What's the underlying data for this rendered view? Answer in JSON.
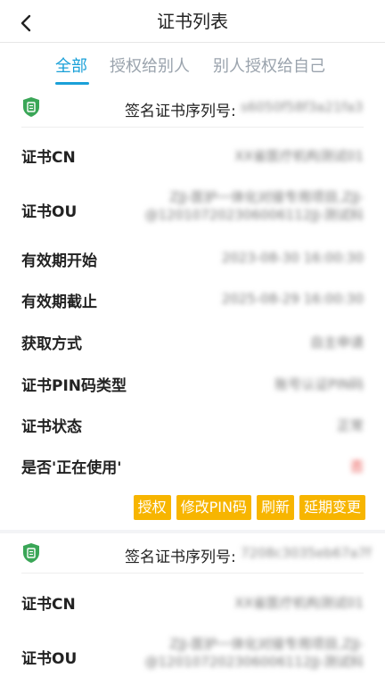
{
  "header": {
    "title": "证书列表",
    "back_icon": "back-chevron-icon"
  },
  "tabs": [
    {
      "label": "全部",
      "active": true
    },
    {
      "label": "授权给别人",
      "active": false
    },
    {
      "label": "别人授权给自己",
      "active": false
    }
  ],
  "colors": {
    "accent": "#1aa0d8",
    "button": "#f7b500",
    "shield": "#3aa657",
    "status_red": "#e53935"
  },
  "certificates": [
    {
      "serial_label": "签名证书序列号:",
      "serial_value": "s6050f58f3a21fa3",
      "fields": [
        {
          "label": "证书CN",
          "value": "XX省医疗机构测试01"
        },
        {
          "label": "证书OU",
          "value": "ZJJ-医护一体化对接专用项目,ZJJ-@120107202306006112JJ-测试科"
        },
        {
          "label": "有效期开始",
          "value": "2023-08-30 16:00:30"
        },
        {
          "label": "有效期截止",
          "value": "2025-08-29 16:00:30"
        },
        {
          "label": "获取方式",
          "value": "自主申请"
        },
        {
          "label": "证书PIN码类型",
          "value": "账号认证PIN码"
        },
        {
          "label": "证书状态",
          "value": "正常"
        },
        {
          "label": "是否'正在使用'",
          "value": "否"
        }
      ],
      "actions": [
        "授权",
        "修改PIN码",
        "刷新",
        "延期变更"
      ]
    },
    {
      "serial_label": "签名证书序列号:",
      "serial_value": "7208c3035eb67a7f",
      "fields": [
        {
          "label": "证书CN",
          "value": "XX省医疗机构测试01"
        },
        {
          "label": "证书OU",
          "value": "ZJJ-医护一体化对接专用项目,ZJJ-@120107202306006112JJ-测试科"
        }
      ]
    }
  ]
}
